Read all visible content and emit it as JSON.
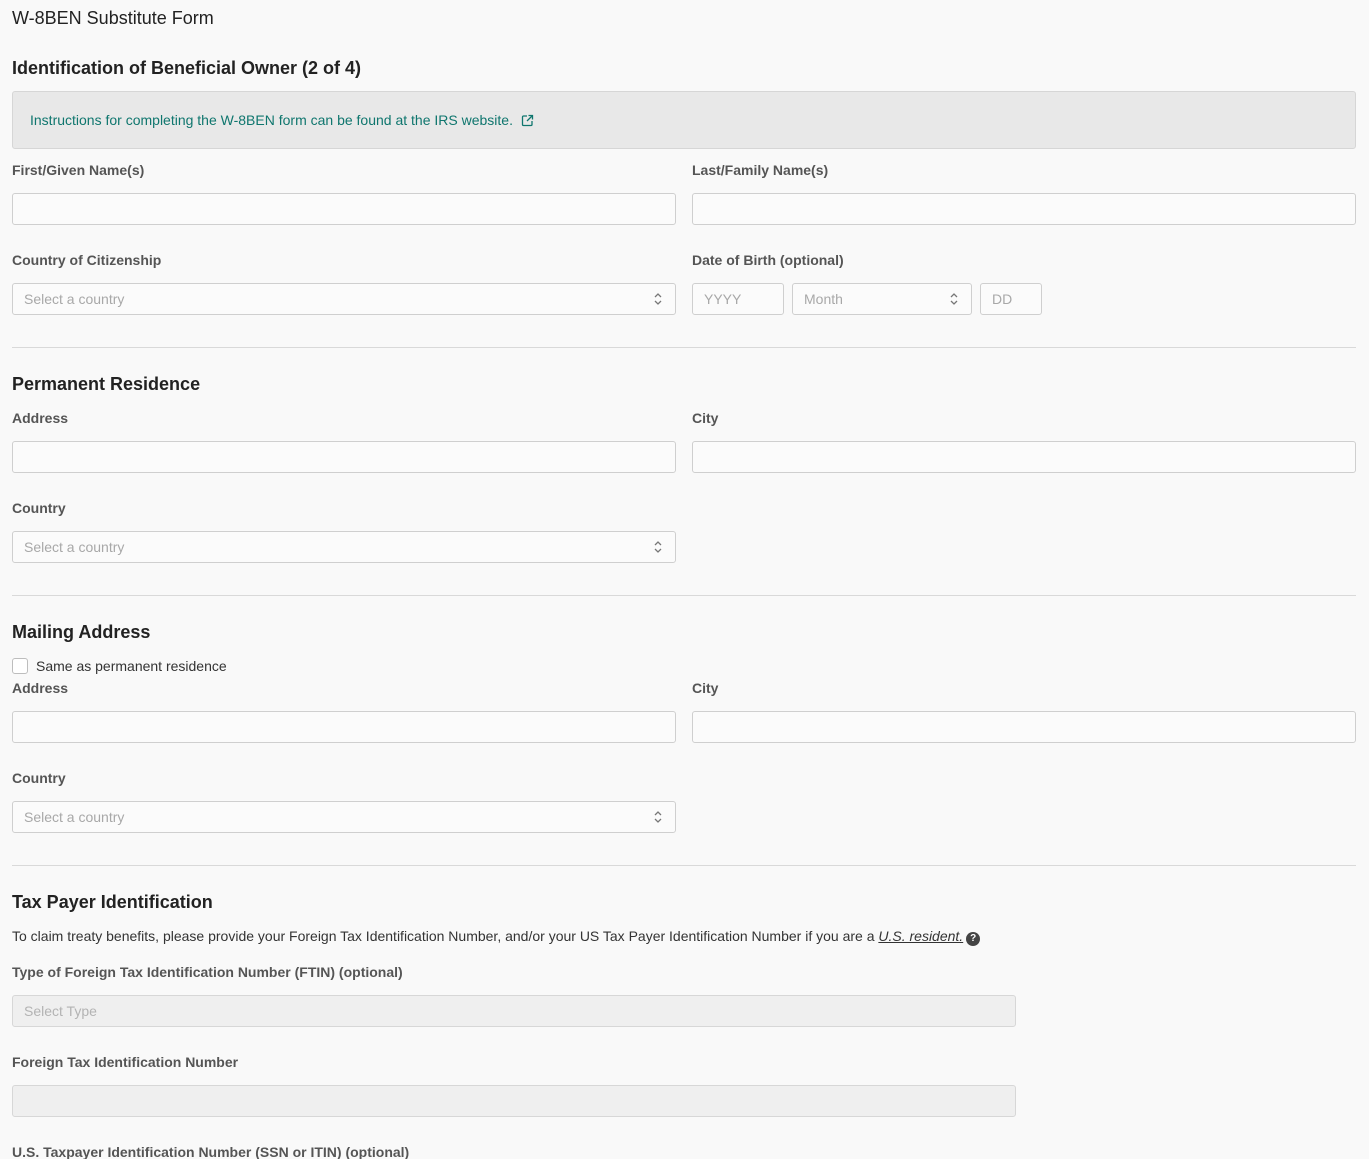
{
  "page": {
    "title": "W-8BEN Substitute Form"
  },
  "identification": {
    "heading": "Identification of Beneficial Owner (2 of 4)",
    "banner_text": "Instructions for completing the W-8BEN form can be found at the IRS website.",
    "first_name_label": "First/Given Name(s)",
    "last_name_label": "Last/Family Name(s)",
    "citizenship_label": "Country of Citizenship",
    "citizenship_placeholder": "Select a country",
    "dob_label": "Date of Birth (optional)",
    "dob_year_placeholder": "YYYY",
    "dob_month_placeholder": "Month",
    "dob_day_placeholder": "DD"
  },
  "permanent_residence": {
    "heading": "Permanent Residence",
    "address_label": "Address",
    "city_label": "City",
    "country_label": "Country",
    "country_placeholder": "Select a country"
  },
  "mailing_address": {
    "heading": "Mailing Address",
    "same_as_label": "Same as permanent residence",
    "address_label": "Address",
    "city_label": "City",
    "country_label": "Country",
    "country_placeholder": "Select a country"
  },
  "tax_id": {
    "heading": "Tax Payer Identification",
    "description": "To claim treaty benefits, please provide your Foreign Tax Identification Number, and/or your US Tax Payer Identification Number if you are a",
    "resident_link": "U.S. resident.",
    "help_glyph": "?",
    "ftin_type_label": "Type of Foreign Tax Identification Number (FTIN) (optional)",
    "ftin_type_placeholder": "Select Type",
    "ftin_label": "Foreign Tax Identification Number",
    "us_tin_label": "U.S. Taxpayer Identification Number (SSN or ITIN) (optional)"
  },
  "colors": {
    "link_teal": "#0f766e",
    "banner_bg": "#e8e8e8",
    "page_bg": "#f9f9f9"
  }
}
